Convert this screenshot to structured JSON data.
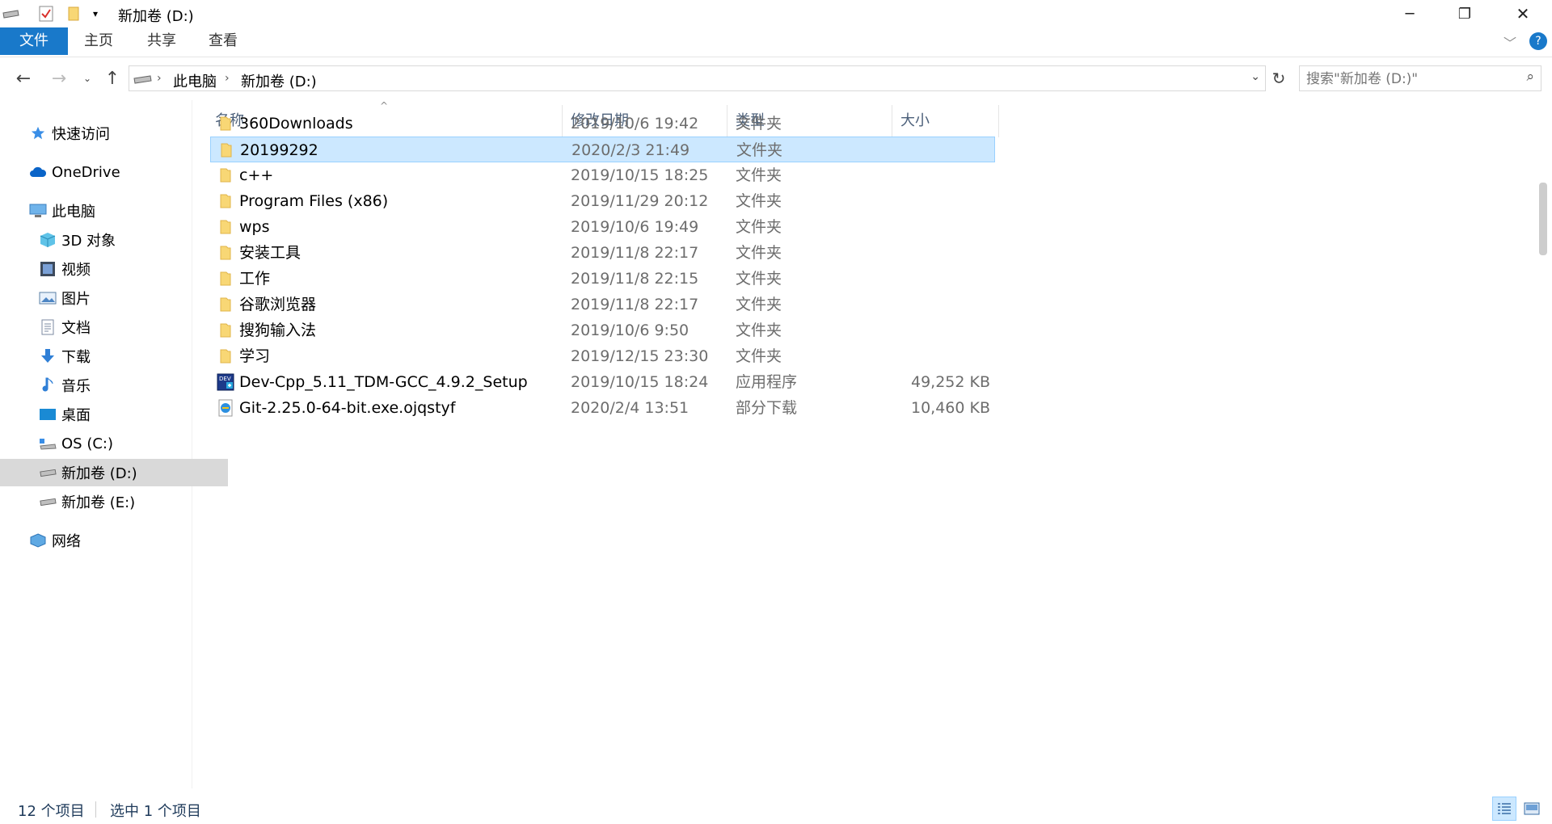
{
  "window": {
    "title": "新加卷 (D:)",
    "controls": {
      "minimize": "─",
      "maximize": "❐",
      "close": "✕"
    }
  },
  "ribbon": {
    "tabs": [
      {
        "label": "文件",
        "active": true
      },
      {
        "label": "主页"
      },
      {
        "label": "共享"
      },
      {
        "label": "查看"
      }
    ]
  },
  "address": {
    "crumbs": [
      "此电脑",
      "新加卷 (D:)"
    ],
    "search_placeholder": "搜索\"新加卷 (D:)\""
  },
  "sidebar": {
    "items": [
      {
        "label": "快速访问",
        "icon": "star-icon"
      },
      {
        "label": "OneDrive",
        "icon": "cloud-icon"
      },
      {
        "label": "此电脑",
        "icon": "computer-icon"
      },
      {
        "label": "3D 对象",
        "icon": "cube-icon"
      },
      {
        "label": "视频",
        "icon": "video-icon"
      },
      {
        "label": "图片",
        "icon": "picture-icon"
      },
      {
        "label": "文档",
        "icon": "document-icon"
      },
      {
        "label": "下载",
        "icon": "download-icon"
      },
      {
        "label": "音乐",
        "icon": "music-icon"
      },
      {
        "label": "桌面",
        "icon": "desktop-icon"
      },
      {
        "label": "OS (C:)",
        "icon": "os-drive-icon"
      },
      {
        "label": "新加卷 (D:)",
        "icon": "drive-icon",
        "selected": true
      },
      {
        "label": "新加卷 (E:)",
        "icon": "drive-icon"
      },
      {
        "label": "网络",
        "icon": "network-icon"
      }
    ]
  },
  "columns": {
    "name": "名称",
    "date": "修改日期",
    "type": "类型",
    "size": "大小"
  },
  "files": [
    {
      "name": "360Downloads",
      "date": "2019/10/6 19:42",
      "type": "文件夹",
      "size": "",
      "icon": "folder-icon"
    },
    {
      "name": "20199292",
      "date": "2020/2/3 21:49",
      "type": "文件夹",
      "size": "",
      "icon": "folder-icon",
      "selected": true
    },
    {
      "name": "c++",
      "date": "2019/10/15 18:25",
      "type": "文件夹",
      "size": "",
      "icon": "folder-icon"
    },
    {
      "name": "Program Files (x86)",
      "date": "2019/11/29 20:12",
      "type": "文件夹",
      "size": "",
      "icon": "folder-icon"
    },
    {
      "name": "wps",
      "date": "2019/10/6 19:49",
      "type": "文件夹",
      "size": "",
      "icon": "folder-icon"
    },
    {
      "name": "安装工具",
      "date": "2019/11/8 22:17",
      "type": "文件夹",
      "size": "",
      "icon": "folder-icon"
    },
    {
      "name": "工作",
      "date": "2019/11/8 22:15",
      "type": "文件夹",
      "size": "",
      "icon": "folder-icon"
    },
    {
      "name": "谷歌浏览器",
      "date": "2019/11/8 22:17",
      "type": "文件夹",
      "size": "",
      "icon": "folder-icon"
    },
    {
      "name": "搜狗输入法",
      "date": "2019/10/6 9:50",
      "type": "文件夹",
      "size": "",
      "icon": "folder-icon"
    },
    {
      "name": "学习",
      "date": "2019/12/15 23:30",
      "type": "文件夹",
      "size": "",
      "icon": "folder-icon"
    },
    {
      "name": "Dev-Cpp_5.11_TDM-GCC_4.9.2_Setup",
      "date": "2019/10/15 18:24",
      "type": "应用程序",
      "size": "49,252 KB",
      "icon": "devcpp-app-icon"
    },
    {
      "name": "Git-2.25.0-64-bit.exe.ojqstyf",
      "date": "2020/2/4 13:51",
      "type": "部分下载",
      "size": "10,460 KB",
      "icon": "ie-download-icon"
    }
  ],
  "status": {
    "count": "12 个项目",
    "selected": "选中 1 个项目"
  },
  "colors": {
    "accent": "#1979ca",
    "selection": "#cce8ff",
    "selection_border": "#99d1ff",
    "folder": "#f8d775",
    "muted": "#6d6d6d"
  }
}
